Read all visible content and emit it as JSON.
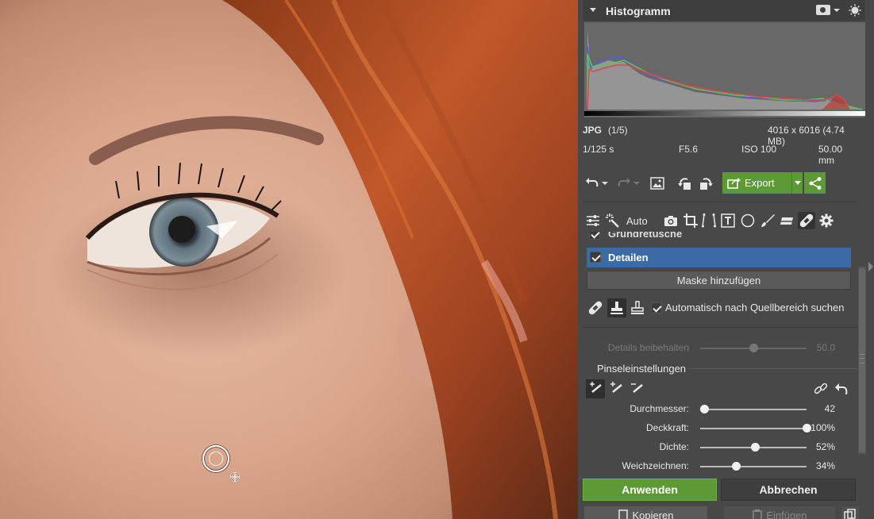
{
  "histogram": {
    "title": "Histogramm",
    "format": "JPG",
    "index": "(1/5)",
    "dimensions": "4016 x 6016 (4.74 MB)",
    "shutter": "1/125 s",
    "aperture": "F5.6",
    "iso": "ISO 100",
    "focal": "50.00 mm"
  },
  "toolbar": {
    "export_label": "Export",
    "auto_label": "Auto"
  },
  "layers": {
    "grund_label": "Grundretusche",
    "detail_label": "Detailen",
    "mask_button": "Maske hinzufügen"
  },
  "clone": {
    "auto_search_label": "Automatisch nach Quellbereich suchen"
  },
  "details_keep": {
    "label": "Details beibehalten",
    "value": "50.0",
    "level": 0.5
  },
  "brush": {
    "section_title": "Pinseleinstellungen",
    "sliders": [
      {
        "label": "Durchmesser:",
        "value": "42",
        "level": 0.04
      },
      {
        "label": "Deckkraft:",
        "value": "100%",
        "level": 1.0
      },
      {
        "label": "Dichte:",
        "value": "52%",
        "level": 0.52
      },
      {
        "label": "Weichzeichnen:",
        "value": "34%",
        "level": 0.34
      }
    ]
  },
  "actions": {
    "apply": "Anwenden",
    "cancel": "Abbrechen",
    "copy": "Kopieren",
    "paste": "Einfügen"
  },
  "colors": {
    "accent_green": "#5d9a36",
    "selection_blue": "#3b6ba5",
    "panel_bg": "#484848"
  }
}
